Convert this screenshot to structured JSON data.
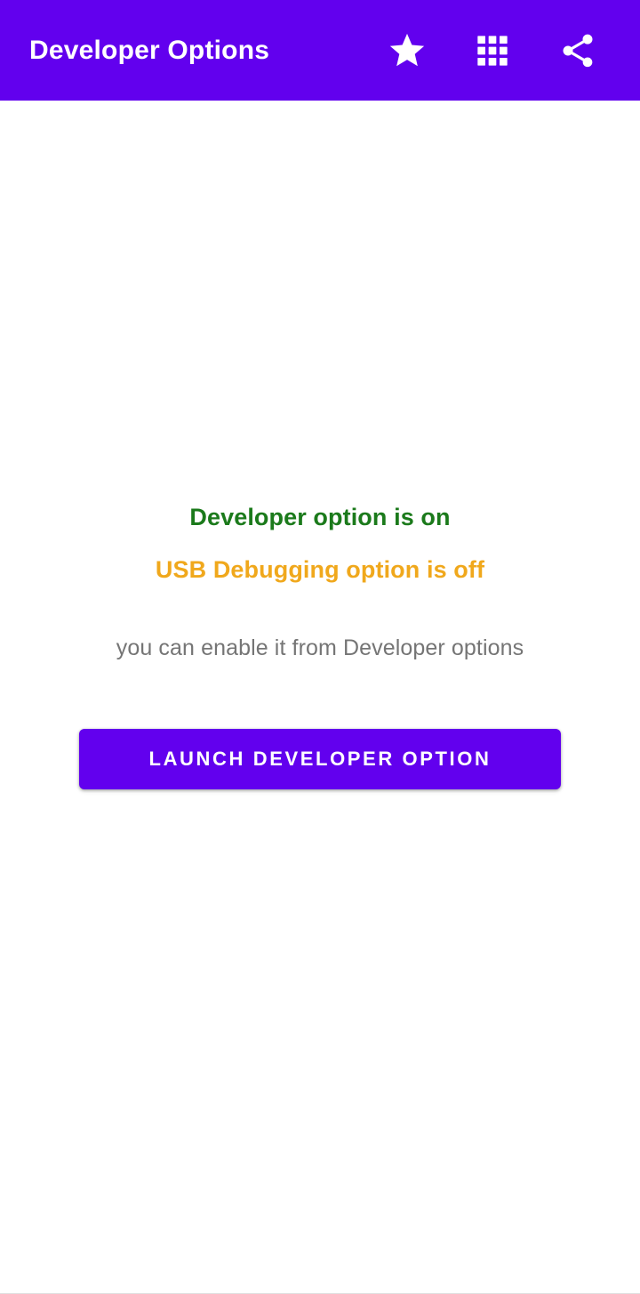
{
  "appbar": {
    "title": "Developer Options",
    "background_color": "#6200EE",
    "title_color": "#FFFFFF",
    "actions": [
      {
        "name": "star-icon",
        "label": "Favorite"
      },
      {
        "name": "apps-grid-icon",
        "label": "Apps"
      },
      {
        "name": "share-icon",
        "label": "Share"
      }
    ]
  },
  "main": {
    "status_developer_option": "Developer option is on",
    "status_developer_option_color": "#1B7A1B",
    "status_usb_debugging": "USB Debugging option is off",
    "status_usb_debugging_color": "#F0A81C",
    "hint": "you can enable it from Developer options",
    "hint_color": "#757575",
    "launch_button_label": "Launch Developer Option",
    "launch_button_color": "#6200EE"
  },
  "page": {
    "background_color": "#FFFFFF"
  }
}
